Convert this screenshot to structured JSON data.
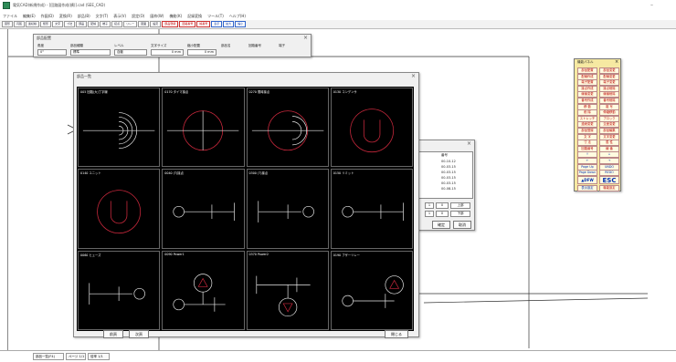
{
  "window": {
    "title": "電気CAD(新規作成) - [回路図作成(横)].cad (SEE_CAD)",
    "minimize_glyph": "–"
  },
  "menu": [
    "ファイル",
    "編集(E)",
    "作図(D)",
    "変換(R)",
    "部品(B)",
    "文字(T)",
    "表示(V)",
    "設定(O)",
    "図枠(W)",
    "機能(K)",
    "記録変換",
    "ツール(T)",
    "ヘルプ(H)"
  ],
  "toolbar": {
    "buttons": [
      "図形",
      "円弧",
      "連続線",
      "矩形",
      "文字",
      "寸法",
      "部品",
      "配線",
      "端子",
      "接点",
      "リレー",
      "図面",
      "設定"
    ],
    "red_buttons": [
      "部品登録",
      "回路番号",
      "線番号"
    ],
    "blue_buttons": [
      "表示",
      "拡大",
      "縮小"
    ]
  },
  "settings_dialog": {
    "title": "部品配置",
    "labels": [
      "角度",
      "部品種類",
      "レベル",
      "文字サイズ",
      "縮小配置",
      "部品名",
      "回路番号",
      "端子"
    ],
    "fields": [
      "0°",
      "標準",
      "自動",
      "0 mm",
      "0 mm"
    ]
  },
  "parts_dialog": {
    "title": "部品一覧",
    "close_glyph": "×",
    "cells": [
      {
        "label": "005 回路(大)丁字線"
      },
      {
        "label": "0170 タイマ接点"
      },
      {
        "label": "0270 限時接点"
      },
      {
        "label": "0130 コンデンサ"
      },
      {
        "label": "0140 ユニット"
      },
      {
        "label": "0040 (T)接点"
      },
      {
        "label": "0300 (T)接点"
      },
      {
        "label": "0150 リミット"
      },
      {
        "label": "0060 ヒューズ"
      },
      {
        "label": "0090 Power1"
      },
      {
        "label": "0370 Power2"
      },
      {
        "label": "0190 ブザーリレー"
      }
    ],
    "prev_button": "前頁",
    "next_button": "次頁",
    "ok_button": "閉じる"
  },
  "list_dialog": {
    "close_glyph": "×",
    "column_header": "番号",
    "rows": [
      "00-10-12",
      "00-03-15",
      "00-03-15",
      "00-03-15",
      "00-03-15",
      "00-08-15"
    ],
    "radio_a": [
      "1",
      "0"
    ],
    "radio_b": [
      "上部",
      "下部"
    ],
    "confirm_button": "確定",
    "cancel_button": "取消"
  },
  "palette": {
    "title": "機能パネル",
    "close_glyph": "×",
    "buttons": [
      [
        "部品配置",
        "部品変更"
      ],
      [
        "配線作成",
        "配線変更"
      ],
      [
        "端子配置",
        "端子変更"
      ],
      [
        "接点作成",
        "接点削除"
      ],
      [
        "線番変更",
        "線番削除"
      ],
      [
        "番号作成",
        "番号削除"
      ],
      [
        "移 動",
        "複 写"
      ],
      [
        "削 除",
        "伸縮移動"
      ],
      [
        "ストレッチ",
        "ブロック"
      ],
      [
        "連続変更",
        "交差変更"
      ],
      [
        "部品登録",
        "部品編集"
      ],
      [
        "文 字",
        "文字変更"
      ],
      [
        "寸 法",
        "属 性"
      ],
      [
        "回路番号",
        "線 番"
      ],
      [
        "↑",
        "↓"
      ],
      [
        "←",
        "→"
      ],
      [
        "Page Up",
        "UNDO"
      ],
      [
        "Page Down",
        "REDO"
      ]
    ],
    "logo": "DFW",
    "esc_button": "ESC",
    "footer": [
      "表示設定",
      "機能設定"
    ]
  },
  "status": [
    "部品一覧(F4)",
    "ページ 1/1",
    "倍率 1/1"
  ],
  "colors": {
    "accent": "#2e8b57",
    "symbol_red": "#c8283c",
    "symbol_white": "#e8e8e8"
  }
}
